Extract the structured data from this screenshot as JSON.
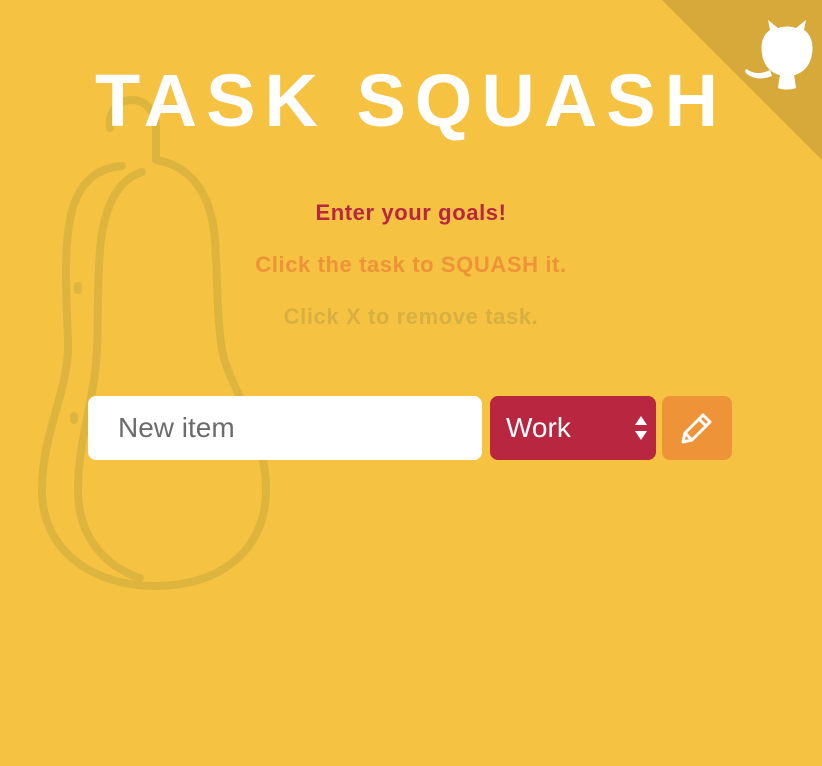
{
  "header": {
    "title": "TASK SQUASH"
  },
  "instructions": {
    "line1": "Enter your goals!",
    "line2": "Click the task to SQUASH it.",
    "line3": "Click X to remove task."
  },
  "form": {
    "task_placeholder": "New item",
    "category_selected": "Work",
    "submit_icon": "pencil-icon"
  },
  "icons": {
    "corner": "github-octocat-icon",
    "background": "butternut-squash-icon"
  },
  "colors": {
    "background": "#F5C242",
    "title": "#FFFFFF",
    "line1": "#B8273F",
    "line2": "#EE9338",
    "line3": "#D8B040",
    "select_bg": "#B8273F",
    "button_bg": "#EE9338",
    "corner": "#D6A93A",
    "squash_outline": "#DDB53E"
  }
}
